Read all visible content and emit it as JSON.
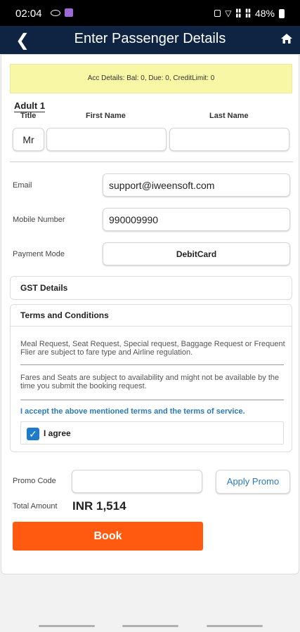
{
  "status_bar": {
    "time": "02:04",
    "battery": "48%"
  },
  "header": {
    "title": "Enter Passenger Details",
    "back_icon": "back-arrow-icon",
    "home_icon": "home-icon"
  },
  "account": {
    "details": "Acc Details: Bal: 0, Due: 0, CreditLimit: 0"
  },
  "passenger": {
    "heading": "Adult 1",
    "title_label": "Title",
    "first_name_label": "First Name",
    "last_name_label": "Last Name",
    "title_value": "Mr",
    "first_name_value": "",
    "last_name_value": ""
  },
  "contact": {
    "email_label": "Email",
    "email_value": "support@iweensoft.com",
    "mobile_label": "Mobile Number",
    "mobile_value": "990009990",
    "payment_label": "Payment Mode",
    "payment_value": "DebitCard"
  },
  "gst": {
    "label": "GST Details"
  },
  "terms": {
    "heading": "Terms and Conditions",
    "paragraph1": "Meal Request, Seat Request, Special request, Baggage Request or Frequent Flier are subject to fare type and Airline regulation.",
    "paragraph2": "Fares and Seats are subject to availability and might not be available by the time you submit the booking request.",
    "accept_text": "I accept the above mentioned terms and the terms of service.",
    "agree_label": "I agree",
    "agree_checked": true
  },
  "promo": {
    "label": "Promo Code",
    "value": "",
    "apply_label": "Apply Promo"
  },
  "total": {
    "label": "Total Amount",
    "value": "INR 1,514"
  },
  "book_label": "Book",
  "colors": {
    "header_bg": "#0f2442",
    "book_button": "#ff5a10",
    "info_banner": "#f7f7a6",
    "link_blue": "#2a7ab8",
    "checkbox": "#1f7bc9"
  }
}
